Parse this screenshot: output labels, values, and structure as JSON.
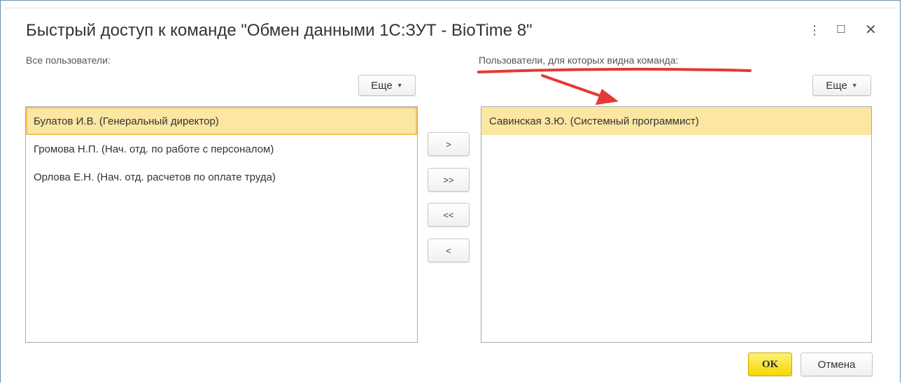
{
  "dialog": {
    "title": "Быстрый доступ к команде \"Обмен данными 1С:ЗУТ - BioTime 8\"",
    "menu_icon": "kebab-menu-icon",
    "maximize_icon": "maximize-icon",
    "close_icon": "close-icon"
  },
  "left_panel": {
    "label": "Все пользователи:",
    "more_label": "Еще",
    "items": [
      "Булатов И.В. (Генеральный директор)",
      "Громова Н.П. (Нач. отд. по работе с персоналом)",
      "Орлова Е.Н. (Нач. отд. расчетов по оплате труда)"
    ]
  },
  "right_panel": {
    "label": "Пользователи, для которых видна команда:",
    "more_label": "Еще",
    "items": [
      "Савинская З.Ю. (Системный программист)"
    ]
  },
  "move_buttons": {
    "add": ">",
    "add_all": ">>",
    "remove_all": "<<",
    "remove": "<"
  },
  "footer": {
    "ok_label": "OK",
    "cancel_label": "Отмена"
  },
  "colors": {
    "selection": "#fbe6a2",
    "ok_button": "#f5d800",
    "annotation": "#e53935"
  }
}
